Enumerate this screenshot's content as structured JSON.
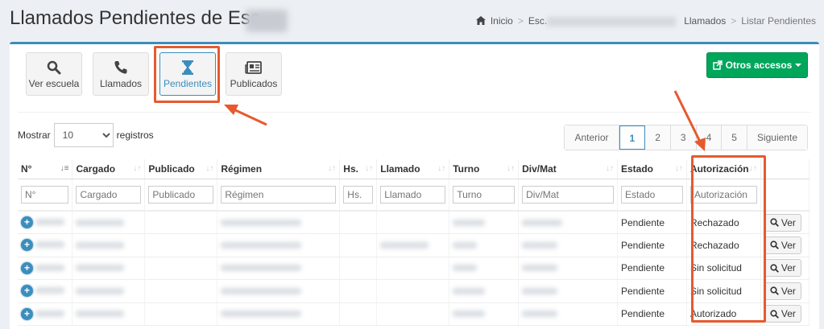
{
  "header": {
    "title": "Llamados Pendientes de Esc.",
    "breadcrumb": {
      "home": "Inicio",
      "school": "Esc.",
      "calls": "Llamados",
      "current": "Listar Pendientes"
    }
  },
  "toolbar": {
    "buttons": [
      {
        "label": "Ver escuela",
        "icon": "search-icon"
      },
      {
        "label": "Llamados",
        "icon": "phone-icon"
      },
      {
        "label": "Pendientes",
        "icon": "hourglass-icon"
      },
      {
        "label": "Publicados",
        "icon": "newspaper-icon"
      }
    ],
    "otros_label": "Otros accesos"
  },
  "length": {
    "prefix": "Mostrar",
    "value": "10",
    "suffix": "registros"
  },
  "pager": {
    "prev": "Anterior",
    "pages": [
      "1",
      "2",
      "3",
      "4",
      "5"
    ],
    "current": "1",
    "next": "Siguiente"
  },
  "table": {
    "columns": [
      "N°",
      "Cargado",
      "Publicado",
      "Régimen",
      "Hs.",
      "Llamado",
      "Turno",
      "Div/Mat",
      "Estado",
      "Autorización"
    ],
    "filters": [
      "N°",
      "Cargado",
      "Publicado",
      "Régimen",
      "Hs.",
      "Llamado",
      "Turno",
      "Div/Mat",
      "Estado",
      "Autorización"
    ],
    "rows": [
      {
        "estado": "Pendiente",
        "autorizacion": "Rechazado",
        "action": "Ver"
      },
      {
        "estado": "Pendiente",
        "autorizacion": "Rechazado",
        "action": "Ver"
      },
      {
        "estado": "Pendiente",
        "autorizacion": "Sin solicitud",
        "action": "Ver"
      },
      {
        "estado": "Pendiente",
        "autorizacion": "Sin solicitud",
        "action": "Ver"
      },
      {
        "estado": "Pendiente",
        "autorizacion": "Autorizado",
        "action": "Ver"
      }
    ]
  },
  "colors": {
    "accent": "#3c8dbc",
    "success": "#00a65a",
    "highlight": "#e65a2e"
  }
}
